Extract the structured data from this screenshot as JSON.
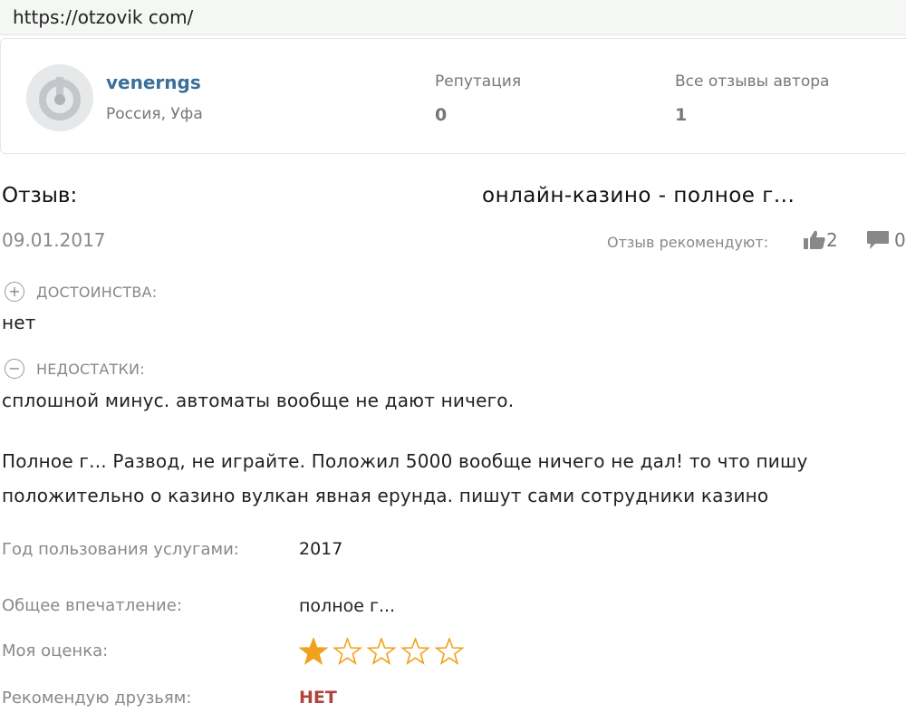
{
  "browser": {
    "url": "https://otzovik com/"
  },
  "author": {
    "username": "venerngs",
    "location": "Россия, Уфа",
    "reputation_label": "Репутация",
    "reputation_value": "0",
    "all_reviews_label": "Все отзывы автора",
    "all_reviews_value": "1"
  },
  "review": {
    "heading": "Отзыв:",
    "title": "онлайн-казино - полное г...",
    "date": "09.01.2017",
    "recommend_label": "Отзыв рекомендуют:",
    "likes": "2",
    "comments": "0",
    "pros_label": "ДОСТОИНСТВА:",
    "pros_text": "нет",
    "cons_label": "НЕДОСТАТКИ:",
    "cons_text": "сплошной минус. автоматы вообще не дают ничего.",
    "body_line1": "Полное г... Развод, не играйте. Положил 5000 вообще ничего не дал! то что пишу",
    "body_line2": "положительно о казино вулкан явная ерунда. пишут сами сотрудники казино"
  },
  "details": {
    "year_label": "Год пользования услугами:",
    "year_value": "2017",
    "impression_label": "Общее впечатление:",
    "impression_value": "полное г...",
    "rating_label": "Моя оценка:",
    "rating_value": 1,
    "rating_max": 5,
    "recommend_friends_label": "Рекомендую друзьям:",
    "recommend_friends_value": "НЕТ"
  },
  "icons": [
    "avatar-placeholder-icon",
    "thumbs-up-icon",
    "comment-bubble-icon",
    "plus-circle-icon",
    "minus-circle-icon",
    "star-icon"
  ],
  "colors": {
    "username": "#3a6f9a",
    "star_filled": "#f0a21e",
    "star_empty": "#f0a21e",
    "negative": "#b0443c"
  }
}
